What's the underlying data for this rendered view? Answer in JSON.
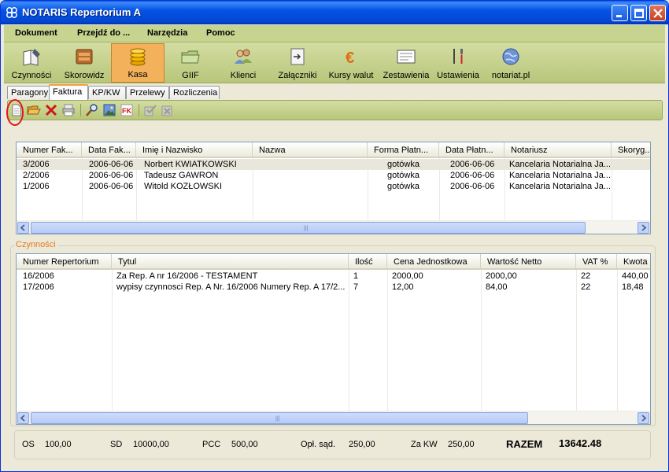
{
  "window": {
    "title": "NOTARIS Repertorium A"
  },
  "menu": [
    {
      "label": "Dokument"
    },
    {
      "label": "Przejdź do ..."
    },
    {
      "label": "Narzędzia"
    },
    {
      "label": "Pomoc"
    }
  ],
  "toolbar": [
    {
      "label": "Czynności",
      "icon": "book-pen-icon"
    },
    {
      "label": "Skorowidz",
      "icon": "index-box-icon"
    },
    {
      "label": "Kasa",
      "icon": "coins-icon",
      "active": true
    },
    {
      "label": "GIIF",
      "icon": "folder-icon"
    },
    {
      "label": "Klienci",
      "icon": "people-icon"
    },
    {
      "label": "Załączniki",
      "icon": "attachment-icon"
    },
    {
      "label": "Kursy walut",
      "icon": "euro-icon"
    },
    {
      "label": "Zestawienia",
      "icon": "report-icon"
    },
    {
      "label": "Ustawienia",
      "icon": "tools-icon"
    },
    {
      "label": "notariat.pl",
      "icon": "globe-icon"
    }
  ],
  "tabs": [
    {
      "label": "Paragony"
    },
    {
      "label": "Faktura",
      "selected": true
    },
    {
      "label": "KP/KW"
    },
    {
      "label": "Przelewy"
    },
    {
      "label": "Rozliczenia"
    }
  ],
  "invoices": {
    "columns": [
      "Numer Fak...",
      "Data Fak...",
      "Imię i Nazwisko",
      "Nazwa",
      "Forma Płatn...",
      "Data Płatn...",
      "Notariusz",
      "Skoryg..."
    ],
    "rows": [
      [
        "3/2006",
        "2006-06-06",
        "Norbert KWIATKOWSKI",
        "",
        "gotówka",
        "2006-06-06",
        "Kancelaria Notarialna Ja...",
        ""
      ],
      [
        "2/2006",
        "2006-06-06",
        "Tadeusz GAWRON",
        "",
        "gotówka",
        "2006-06-06",
        "Kancelaria Notarialna Ja...",
        ""
      ],
      [
        "1/2006",
        "2006-06-06",
        "Witold KOZŁOWSKI",
        "",
        "gotówka",
        "2006-06-06",
        "Kancelaria Notarialna Ja...",
        ""
      ]
    ]
  },
  "activities": {
    "group_title": "Czynności",
    "columns": [
      "Numer Repertorium",
      "Tytul",
      "Ilość",
      "Cena Jednostkowa",
      "Wartość Netto",
      "VAT %",
      "Kwota"
    ],
    "rows": [
      [
        "16/2006",
        "Za Rep. A nr 16/2006 - TESTAMENT",
        "1",
        "2000,00",
        "2000,00",
        "22",
        "440,00"
      ],
      [
        "17/2006",
        "wypisy czynnosci Rep. A Nr. 16/2006 Numery Rep. A 17/2...",
        "7",
        "12,00",
        "84,00",
        "22",
        "18,48"
      ]
    ]
  },
  "totals": {
    "os_label": "OS",
    "os_value": "100,00",
    "sd_label": "SD",
    "sd_value": "10000,00",
    "pcc_label": "PCC",
    "pcc_value": "500,00",
    "opl_label": "Opł. sąd.",
    "opl_value": "250,00",
    "zakw_label": "Za KW",
    "zakw_value": "250,00",
    "razem_label": "RAZEM",
    "razem_value": "13642.48"
  }
}
